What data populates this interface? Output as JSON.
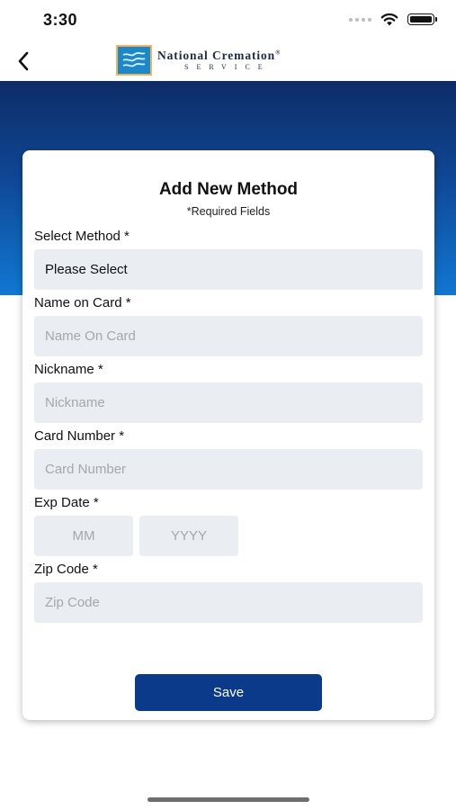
{
  "status_bar": {
    "time": "3:30"
  },
  "header": {
    "logo_name": "National Cremation",
    "logo_sub": "SERVICE",
    "logo_registered": "®"
  },
  "form": {
    "title": "Add New Method",
    "required_note": "*Required Fields",
    "select_method": {
      "label": "Select Method *",
      "value": "Please Select"
    },
    "name_on_card": {
      "label": "Name on Card *",
      "placeholder": "Name On Card"
    },
    "nickname": {
      "label": "Nickname *",
      "placeholder": "Nickname"
    },
    "card_number": {
      "label": "Card Number *",
      "placeholder": "Card Number"
    },
    "exp_date": {
      "label": "Exp Date *",
      "month_placeholder": "MM",
      "year_placeholder": "YYYY"
    },
    "zip_code": {
      "label": "Zip Code *",
      "placeholder": "Zip Code"
    },
    "save_label": "Save"
  },
  "colors": {
    "brand_navy": "#0c3a8a",
    "header_gradient_top": "#0d2c66",
    "header_gradient_bottom": "#1177d2",
    "field_background": "#eaedf1",
    "logo_border": "#f2b35a"
  }
}
